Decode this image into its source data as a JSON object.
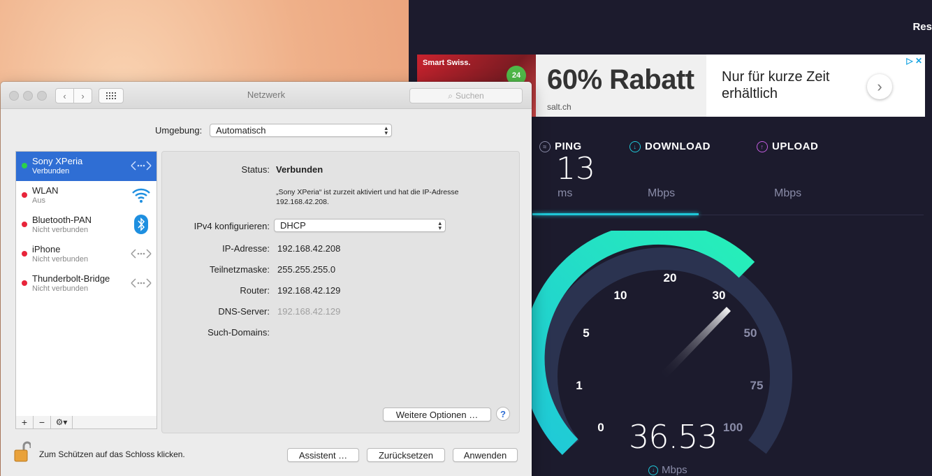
{
  "ad": {
    "brand": "Smart Swiss.",
    "badge": "24",
    "headline": "60% Rabatt",
    "domain": "salt.ch",
    "subline": "Nur für kurze Zeit erhältlich"
  },
  "page_header_partial": "Res",
  "speedtest": {
    "ping_label": "PING",
    "download_label": "DOWNLOAD",
    "upload_label": "UPLOAD",
    "ping_value": "13",
    "ping_unit": "ms",
    "download_unit": "Mbps",
    "upload_unit": "Mbps",
    "gauge_labels": [
      "0",
      "1",
      "5",
      "10",
      "20",
      "30",
      "50",
      "75",
      "100"
    ],
    "current_speed": "36.53",
    "current_unit": "Mbps",
    "accent_color": "#1fc8d8"
  },
  "window": {
    "title": "Netzwerk",
    "search_placeholder": "Suchen",
    "location_label": "Umgebung:",
    "location_value": "Automatisch"
  },
  "services": [
    {
      "name": "Sony XPeria",
      "status": "Verbunden",
      "dot": "#2bd14a",
      "icon": "ethernet-icon"
    },
    {
      "name": "WLAN",
      "status": "Aus",
      "dot": "#e8243a",
      "icon": "wifi-icon"
    },
    {
      "name": "Bluetooth-PAN",
      "status": "Nicht verbunden",
      "dot": "#e8243a",
      "icon": "bluetooth-icon"
    },
    {
      "name": "iPhone",
      "status": "Nicht verbunden",
      "dot": "#e8243a",
      "icon": "ethernet-icon"
    },
    {
      "name": "Thunderbolt-Bridge",
      "status": "Nicht verbunden",
      "dot": "#e8243a",
      "icon": "ethernet-icon"
    }
  ],
  "details": {
    "status_label": "Status:",
    "status_value": "Verbunden",
    "status_note": "„Sony XPeria“ ist zurzeit aktiviert und hat die IP-Adresse 192.168.42.208.",
    "ipv4_label": "IPv4 konfigurieren:",
    "ipv4_value": "DHCP",
    "ip_label": "IP-Adresse:",
    "ip_value": "192.168.42.208",
    "mask_label": "Teilnetzmaske:",
    "mask_value": "255.255.255.0",
    "router_label": "Router:",
    "router_value": "192.168.42.129",
    "dns_label": "DNS-Server:",
    "dns_value": "192.168.42.129",
    "domains_label": "Such-Domains:",
    "more_options": "Weitere Optionen …",
    "help": "?"
  },
  "footer": {
    "lock_text": "Zum Schützen auf das Schloss klicken.",
    "assist": "Assistent …",
    "revert": "Zurücksetzen",
    "apply": "Anwenden"
  }
}
